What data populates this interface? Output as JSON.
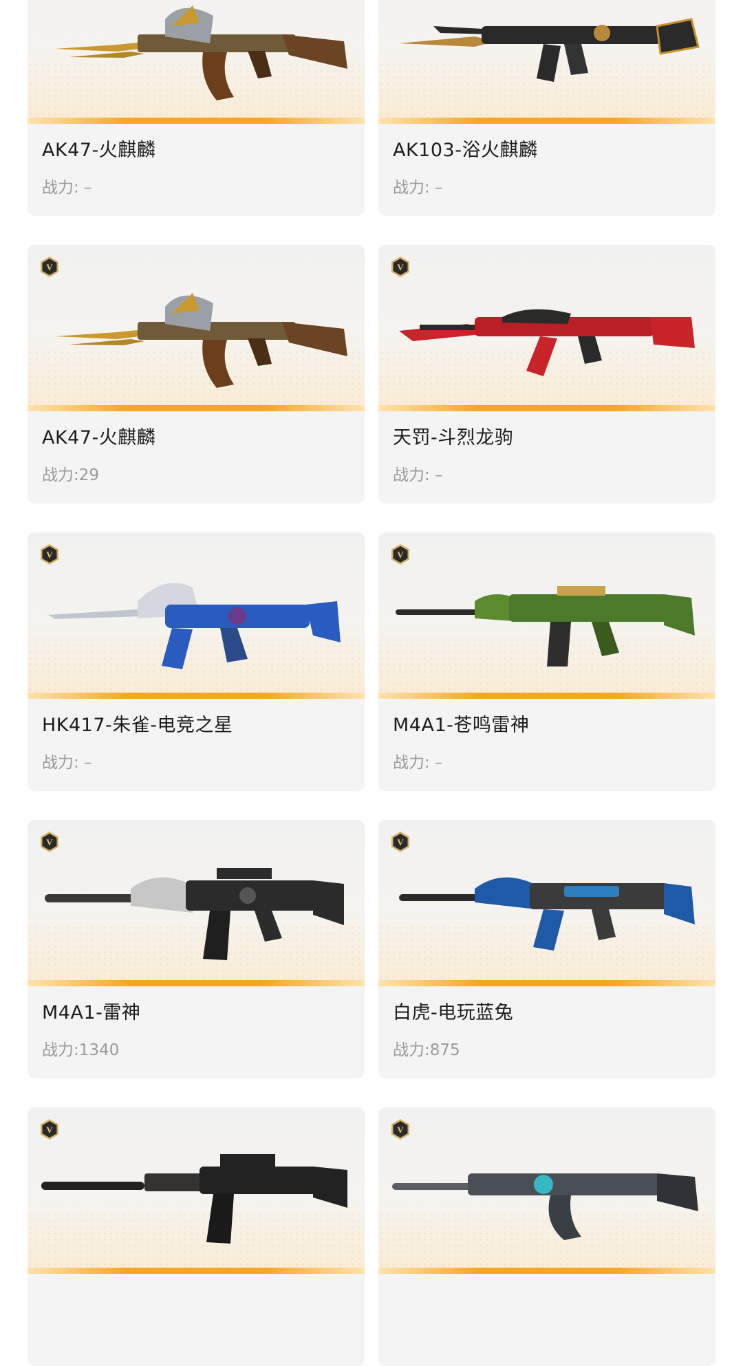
{
  "cards": [
    {
      "name": "AK47-火麒麟",
      "power": "战力: –",
      "vip": false,
      "weapon": "ak47-fire-qilin",
      "colors": [
        "#b8893a",
        "#5a3a1e"
      ]
    },
    {
      "name": "AK103-浴火麒麟",
      "power": "战力: –",
      "vip": false,
      "weapon": "ak103-phoenix-qilin",
      "colors": [
        "#2a2a2a",
        "#c7922e"
      ]
    },
    {
      "name": "AK47-火麒麟",
      "power": "战力:29",
      "vip": true,
      "weapon": "ak47-fire-qilin",
      "colors": [
        "#b8893a",
        "#5a3a1e"
      ]
    },
    {
      "name": "天罚-斗烈龙驹",
      "power": "战力: –",
      "vip": true,
      "weapon": "tianfa-dragon-colt",
      "colors": [
        "#c8242a",
        "#2a2a2a"
      ]
    },
    {
      "name": "HK417-朱雀-电竞之星",
      "power": "战力: –",
      "vip": true,
      "weapon": "hk417-vermilion-esports",
      "colors": [
        "#2a5bbf",
        "#c0c6d0"
      ]
    },
    {
      "name": "M4A1-苍鸣雷神",
      "power": "战力: –",
      "vip": true,
      "weapon": "m4a1-azure-thunder",
      "colors": [
        "#4d7a2a",
        "#c9a24a"
      ]
    },
    {
      "name": "M4A1-雷神",
      "power": "战力:1340",
      "vip": true,
      "weapon": "m4a1-thunder-god",
      "colors": [
        "#2b2b2b",
        "#c7c7c7"
      ]
    },
    {
      "name": "白虎-电玩蓝兔",
      "power": "战力:875",
      "vip": true,
      "weapon": "baihu-game-blue-rabbit",
      "colors": [
        "#1f5aa8",
        "#3b3b3b"
      ]
    },
    {
      "name": "",
      "power": "",
      "vip": true,
      "weapon": "m4a1-standard",
      "colors": [
        "#222222",
        "#555555"
      ]
    },
    {
      "name": "",
      "power": "",
      "vip": true,
      "weapon": "ak-cyan-mech",
      "colors": [
        "#5a5f66",
        "#35b8c4"
      ]
    }
  ],
  "icons": {
    "vip_badge": "vip-v-hexagon-icon"
  },
  "accent": "#f6a623"
}
